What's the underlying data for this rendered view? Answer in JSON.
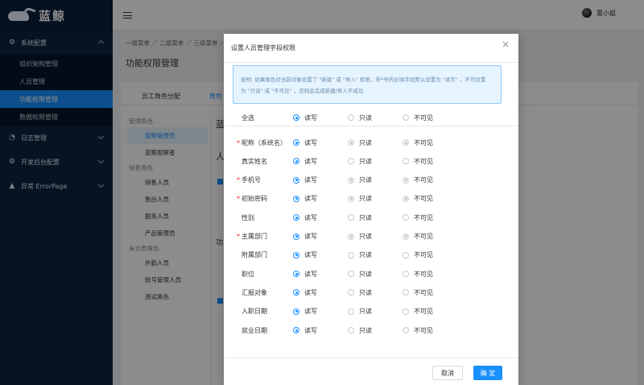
{
  "sidebar": {
    "logo_text": "蓝鲸",
    "groups": [
      {
        "label": "系统配置",
        "icon": "gear-icon",
        "expanded": true
      },
      {
        "label": "日志管理",
        "icon": "dashboard-icon",
        "expanded": false
      },
      {
        "label": "开发后台配置",
        "icon": "gears-icon",
        "expanded": false
      },
      {
        "label": "异常 ErrorPage",
        "icon": "warning-icon",
        "expanded": false
      }
    ],
    "sub_items": [
      "组织架构管理",
      "人员管理",
      "功能权限管理",
      "数据权限管理"
    ],
    "active_sub": 2
  },
  "header": {
    "user_name": "董小姐"
  },
  "background": {
    "breadcrumb": "一级菜单 ／ 二级菜单 ／ 三级菜单 ／",
    "page_title": "功能权限管理",
    "tabs": [
      "员工角色分配",
      "角色"
    ],
    "role_groups": [
      {
        "group": "管理角色",
        "items": [
          "蓝鲸管理员",
          "蓝鲸观察者"
        ]
      },
      {
        "group": "销售角色",
        "items": [
          "销售人员",
          "售后人员",
          "服务人员",
          "产品管理员"
        ]
      },
      {
        "group": "未分类角色",
        "items": [
          "外勤人员",
          "账号管理人员",
          "测试角色"
        ]
      }
    ],
    "right_glyphs": [
      "蓝",
      "人",
      "功"
    ]
  },
  "modal": {
    "title": "设置人员管理字段权限",
    "notice_line1": "说明: 如果角色对当前对象设置了 \"新建\" 或 \"导入\" 权限，带*号的必填字段默认设置为 \"读写\" ，不可设置",
    "notice_line2": "为 \"只读\" 或 \"不可见\" ，否则会造成新建/导入不成功",
    "option_labels": [
      "读写",
      "只读",
      "不可见"
    ],
    "select_all_label": "全选",
    "fields": [
      {
        "label": "昵称（系统名）",
        "required": true
      },
      {
        "label": "真实姓名",
        "required": false
      },
      {
        "label": "手机号",
        "required": true
      },
      {
        "label": "初始密码",
        "required": true
      },
      {
        "label": "性别",
        "required": false
      },
      {
        "label": "主属部门",
        "required": true
      },
      {
        "label": "附属部门",
        "required": false
      },
      {
        "label": "职位",
        "required": false
      },
      {
        "label": "汇报对象",
        "required": false
      },
      {
        "label": "入职日期",
        "required": false
      },
      {
        "label": "就业日期",
        "required": false
      }
    ],
    "required_mark": "*",
    "cancel_label": "取消",
    "ok_label": "确 定",
    "close_glyph": "×"
  },
  "colors": {
    "sidebar_bg": "#0c2341",
    "accent": "#1890ff",
    "required": "#f5222d"
  }
}
